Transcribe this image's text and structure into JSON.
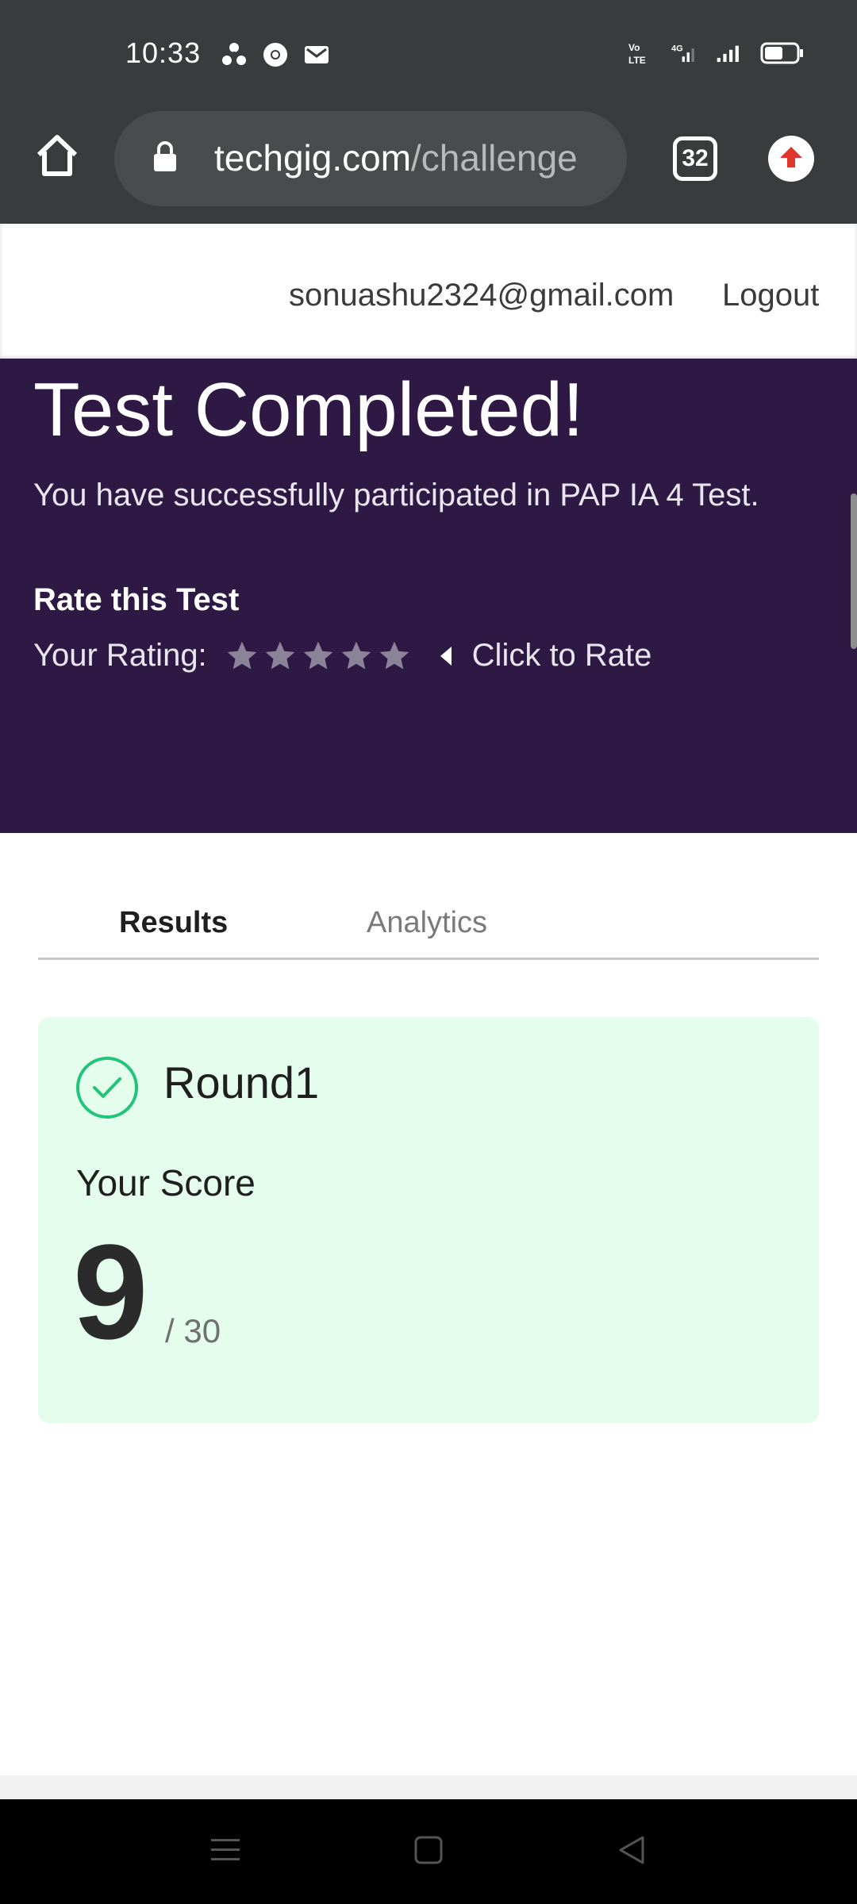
{
  "status_bar": {
    "time": "10:33",
    "left_icons": [
      "sync-icon",
      "chrome-icon",
      "gmail-icon"
    ],
    "right_icons": [
      "volte-icon",
      "signal-4g-icon",
      "signal-icon",
      "battery-icon"
    ],
    "battery": "46"
  },
  "browser": {
    "url_domain": "techgig.com",
    "url_path": "/challenge",
    "tab_count": "32"
  },
  "header": {
    "email": "sonuashu2324@gmail.com",
    "logout": "Logout"
  },
  "hero": {
    "title": "Test Completed!",
    "subtitle": "You have successfully participated in PAP IA 4 Test.",
    "rate_heading": "Rate this Test",
    "rating_label": "Your Rating:",
    "rating_stars_filled": 0,
    "rating_stars_total": 5,
    "click_to_rate": "Click to Rate"
  },
  "tabs": {
    "results": "Results",
    "analytics": "Analytics"
  },
  "result_card": {
    "round_name": "Round1",
    "score_label": "Your Score",
    "score": "9",
    "score_total": "/ 30"
  },
  "colors": {
    "hero_bg": "#2e1944",
    "card_bg": "#e5fdec",
    "success_green": "#22c37a",
    "chrome_bg": "#3a3b3d"
  }
}
